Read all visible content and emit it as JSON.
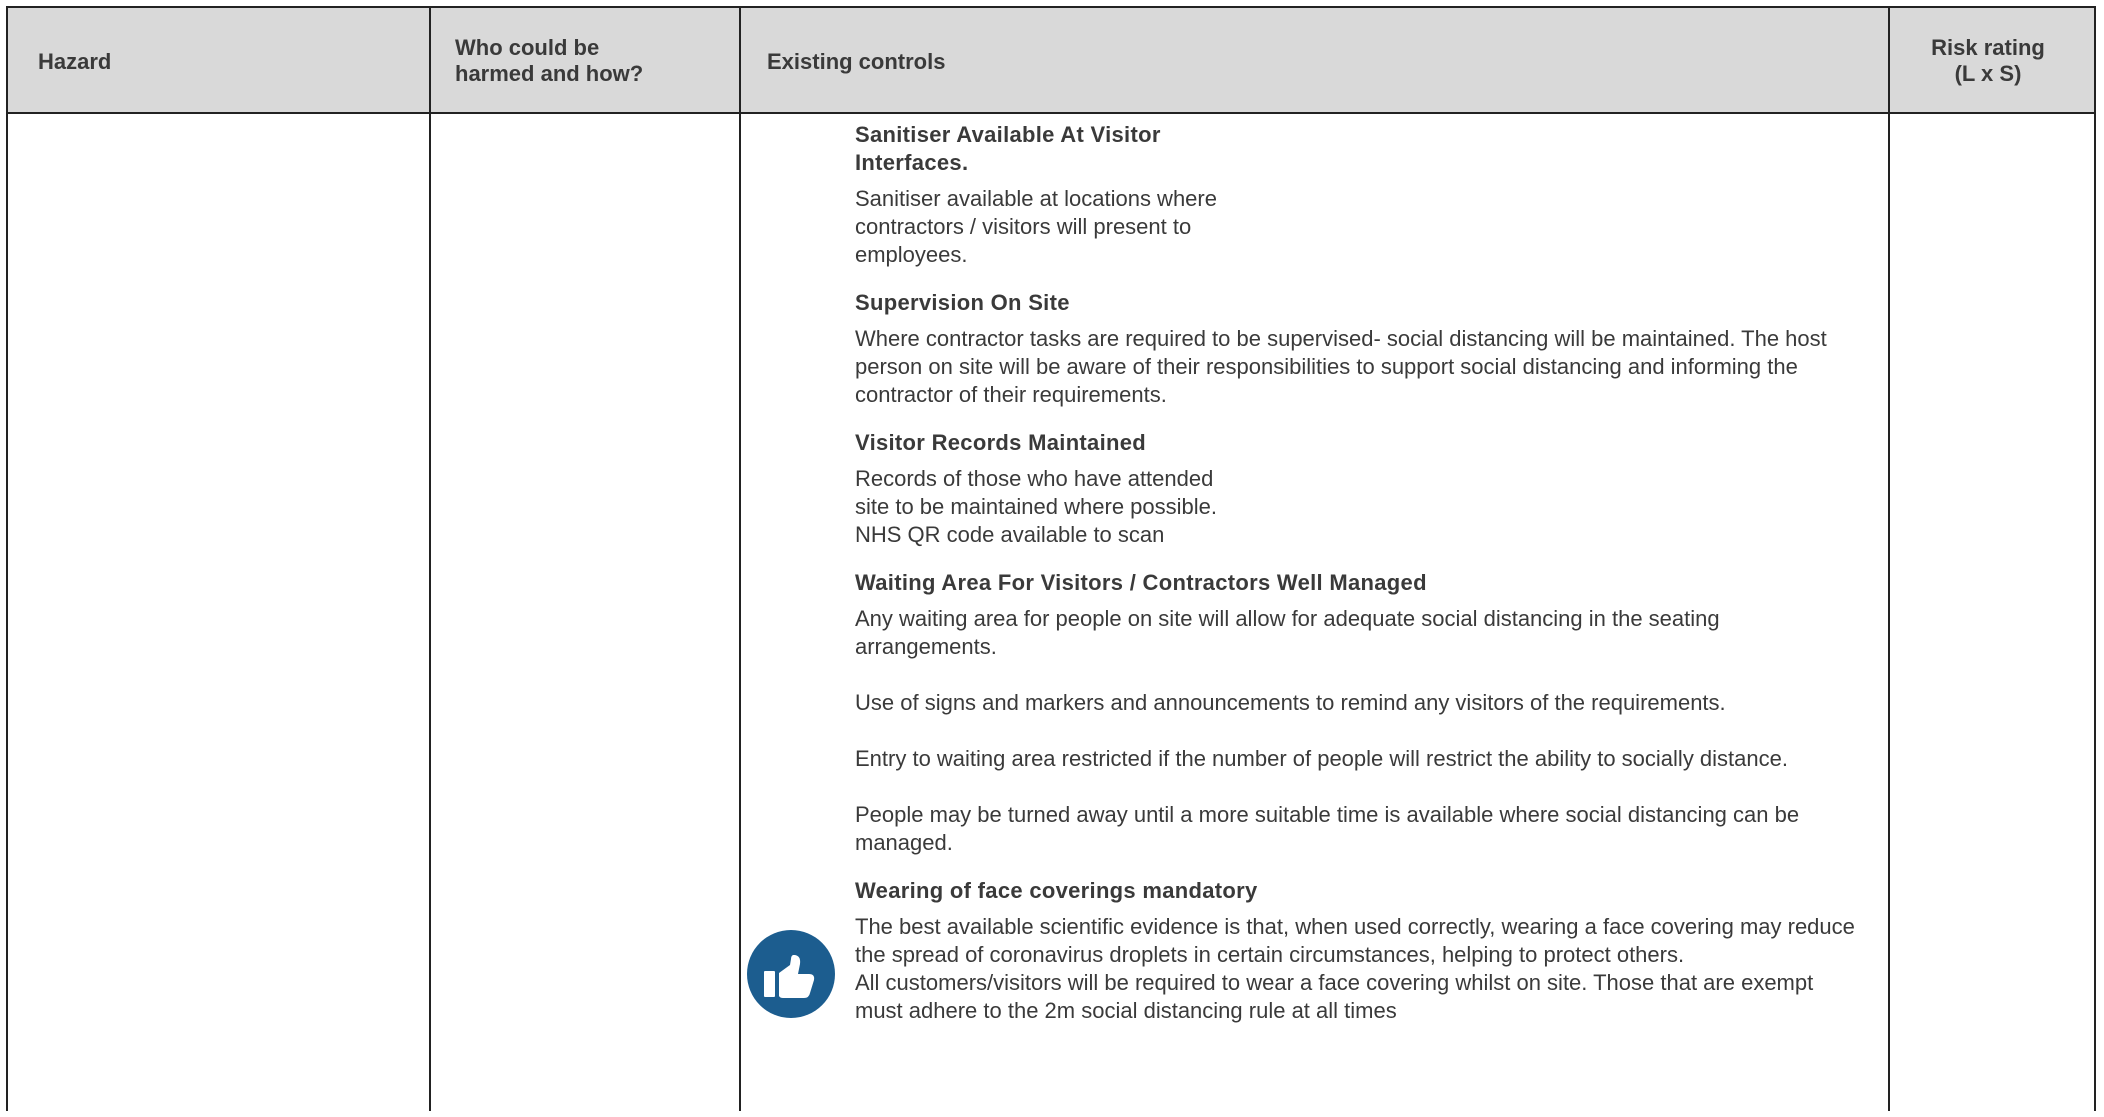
{
  "table": {
    "headers": {
      "hazard": "Hazard",
      "who_harmed": "Who could be\nharmed and how?",
      "existing_controls": "Existing controls",
      "risk_rating": "Risk rating\n(L x S)"
    },
    "controls": [
      {
        "title": "Sanitiser Available At Visitor Interfaces.",
        "paragraphs": [
          "Sanitiser available at locations where contractors / visitors will present to employees."
        ]
      },
      {
        "title": "Supervision On Site",
        "paragraphs": [
          "Where contractor tasks are required to be supervised- social distancing will be maintained. The host person on site will be aware of their responsibilities to support social distancing and informing the contractor of their requirements."
        ]
      },
      {
        "title": "Visitor Records Maintained",
        "paragraphs": [
          "Records of those who have attended\nsite to be maintained where possible.\nNHS QR code available to scan"
        ]
      },
      {
        "title": "Waiting Area For Visitors / Contractors Well Managed",
        "paragraphs": [
          "Any waiting area for people on site will allow for adequate social distancing in the seating arrangements.",
          "Use of signs and markers and announcements to remind any visitors of the requirements.",
          "Entry to waiting area restricted if the number of people will restrict the ability to socially distance.",
          "People may be turned away until a more suitable time is available where social distancing can be managed."
        ]
      },
      {
        "title": "Wearing of face coverings mandatory",
        "paragraphs": [
          "The best available scientific evidence is that, when used correctly, wearing a face covering may reduce the spread of coronavirus droplets in certain circumstances, helping to protect others.\nAll customers/visitors will be required to wear a face covering whilst on site. Those that are exempt must adhere to the 2m social distancing rule at all times"
        ]
      }
    ],
    "icon": "thumbs-up-icon",
    "icon_color": "#1c5d8f",
    "header_bg": "#d9d9d9"
  }
}
